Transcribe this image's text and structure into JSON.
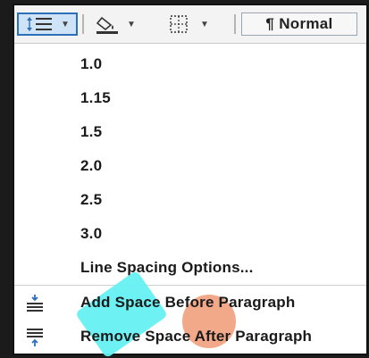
{
  "toolbar": {
    "style_label": "¶ Normal"
  },
  "menu": {
    "items": [
      {
        "label": "1.0"
      },
      {
        "label": "1.15"
      },
      {
        "label": "1.5"
      },
      {
        "label": "2.0"
      },
      {
        "label": "2.5"
      },
      {
        "label": "3.0"
      }
    ],
    "options_label": "Line Spacing Options...",
    "add_space_label": "Add Space Before Paragraph",
    "remove_space_label": "Remove Space After Paragraph"
  },
  "icons": {
    "line_spacing": "line-spacing-icon",
    "shading": "shading-icon",
    "borders": "borders-icon",
    "add_space_before": "add-space-before-icon",
    "remove_space_after": "remove-space-after-icon"
  },
  "colors": {
    "active_button_bg": "#cfe3f7",
    "active_button_border": "#2e6fb9",
    "icon_blue": "#2e6fb9"
  }
}
